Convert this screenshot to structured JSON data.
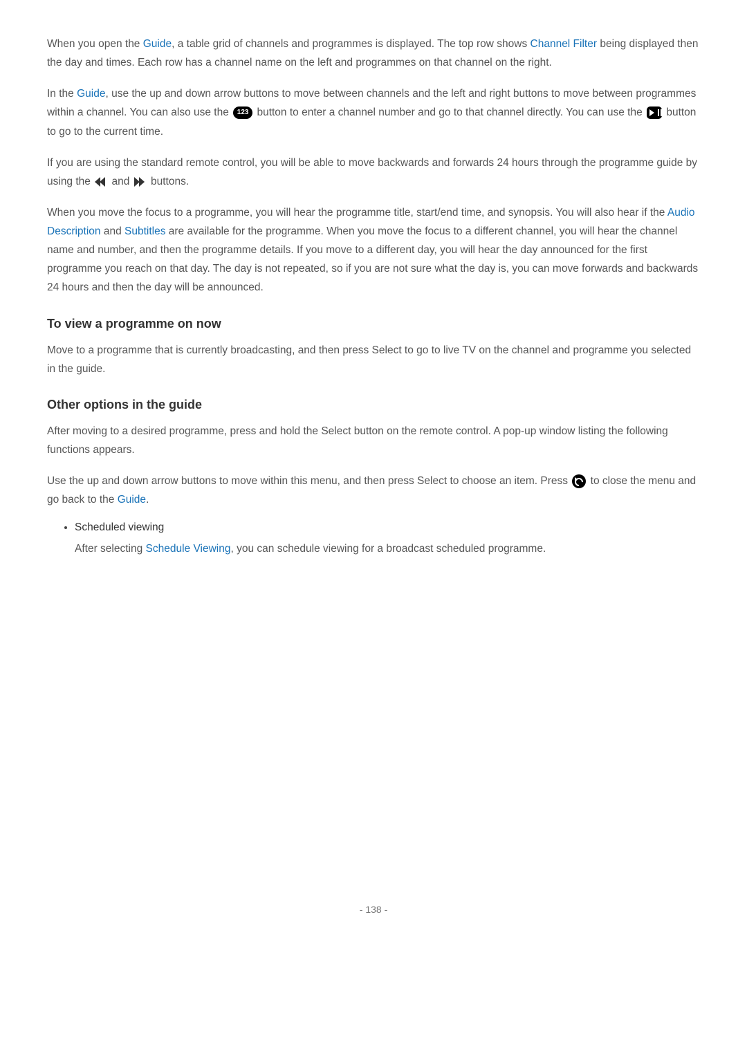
{
  "p1": {
    "t1": "When you open the ",
    "h1": "Guide",
    "t2": ", a table grid of channels and programmes is displayed. The top row shows ",
    "h2": "Channel Filter",
    "t3": " being displayed then the day and times. Each row has a channel name on the left and programmes on that channel on the right."
  },
  "p2": {
    "t1": "In the ",
    "h1": "Guide",
    "t2": ", use the up and down arrow buttons to move between channels and the left and right buttons to move between programmes within a channel. You can also use the ",
    "t3": " button to enter a channel number and go to that channel directly. You can use the ",
    "t4": " button to go to the current time."
  },
  "p3": {
    "t1": "If you are using the standard remote control, you will be able to move backwards and forwards 24 hours through the programme guide by using the ",
    "t2": " and ",
    "t3": " buttons."
  },
  "p4": {
    "t1": "When you move the focus to a programme, you will hear the programme title, start/end time, and synopsis. You will also hear if the ",
    "h1": "Audio Description",
    "t2": " and ",
    "h2": "Subtitles",
    "t3": " are available for the programme. When you move the focus to a different channel, you will hear the channel name and number, and then the programme details. If you move to a different day, you will hear the day announced for the first programme you reach on that day. The day is not repeated, so if you are not sure what the day is, you can move forwards and backwards 24 hours and then the day will be announced."
  },
  "h3a": "To view a programme on now",
  "p5": "Move to a programme that is currently broadcasting, and then press Select to go to live TV on the channel and programme you selected in the guide.",
  "h3b": "Other options in the guide",
  "p6": "After moving to a desired programme, press and hold the Select button on the remote control. A pop-up window listing the following functions appears.",
  "p7": {
    "t1": "Use the up and down arrow buttons to move within this menu, and then press Select to choose an item. Press ",
    "t2": " to close the menu and go back to the ",
    "h1": "Guide",
    "t3": "."
  },
  "bullet1": {
    "title": "Scheduled viewing",
    "t1": "After selecting ",
    "h1": "Schedule Viewing",
    "t2": ", you can schedule viewing for a broadcast scheduled programme."
  },
  "pageNum": "- 138 -",
  "icon123": "123"
}
